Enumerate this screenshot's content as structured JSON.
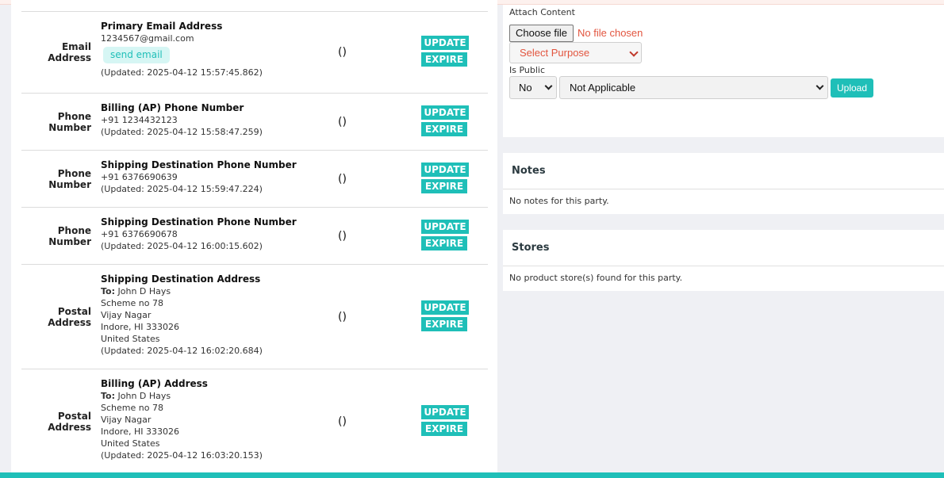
{
  "contacts": [
    {
      "type": "Email Address",
      "purpose": "Primary Email Address",
      "lines": [
        "1234567@gmail.com"
      ],
      "action": "send email",
      "updated": "(Updated: 2025-04-12 15:57:45.862)",
      "count": "()"
    },
    {
      "type": "Phone Number",
      "purpose": "Billing (AP) Phone Number",
      "lines": [
        "+91 1234432123"
      ],
      "updated": "(Updated: 2025-04-12 15:58:47.259)",
      "count": "()"
    },
    {
      "type": "Phone Number",
      "purpose": "Shipping Destination Phone Number",
      "lines": [
        "+91 6376690639"
      ],
      "updated": "(Updated: 2025-04-12 15:59:47.224)",
      "count": "()"
    },
    {
      "type": "Phone Number",
      "purpose": "Shipping Destination Phone Number",
      "lines": [
        "+91 6376690678"
      ],
      "updated": "(Updated: 2025-04-12 16:00:15.602)",
      "count": "()"
    },
    {
      "type": "Postal Address",
      "purpose": "Shipping Destination Address",
      "to_label": "To:",
      "to_name": "John D Hays",
      "lines": [
        "Scheme no 78",
        "Vijay Nagar",
        "Indore, HI 333026",
        "United States"
      ],
      "updated": "(Updated: 2025-04-12 16:02:20.684)",
      "count": "()"
    },
    {
      "type": "Postal Address",
      "purpose": "Billing (AP) Address",
      "to_label": "To:",
      "to_name": "John D Hays",
      "lines": [
        "Scheme no 78",
        "Vijay Nagar",
        "Indore, HI 333026",
        "United States"
      ],
      "updated": "(Updated: 2025-04-12 16:03:20.153)",
      "count": "()"
    }
  ],
  "buttons": {
    "update": "UPDATE",
    "expire": "EXPIRE"
  },
  "attach": {
    "label": "Attach Content",
    "choose_file": "Choose file",
    "file_status": "No file chosen",
    "purpose_select": "Select Purpose",
    "is_public_label": "Is Public",
    "is_public_value": "No",
    "applicable_value": "Not Applicable",
    "upload": "Upload"
  },
  "notes": {
    "title": "Notes",
    "empty": "No notes for this party."
  },
  "stores": {
    "title": "Stores",
    "empty": "No product store(s) found for this party."
  },
  "colors": {
    "accent": "#1fbfb8",
    "error_text": "#e2553f",
    "page_bg": "#eff0f4"
  }
}
